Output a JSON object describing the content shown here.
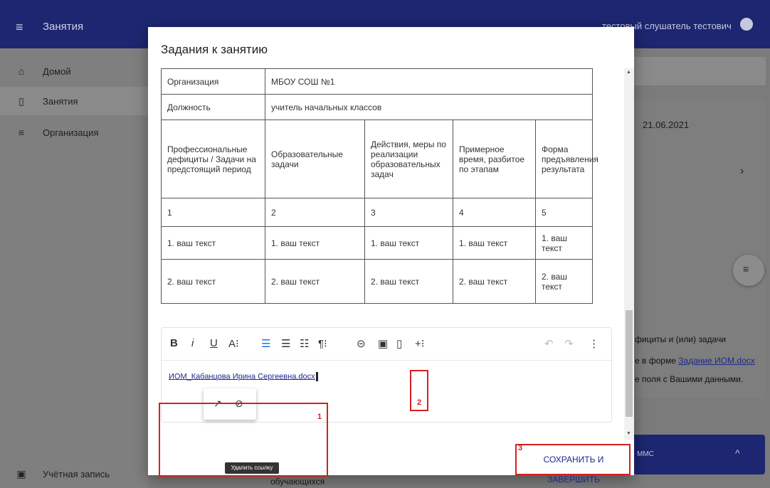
{
  "app_bar": {
    "menu_icon": "menu-icon",
    "title": "Занятия",
    "user_name": "тестовый слушатель тестович",
    "user_icon": "account-icon"
  },
  "sidebar": {
    "items": [
      {
        "icon": "home-icon",
        "glyph": "⌂",
        "label": "Домой"
      },
      {
        "icon": "book-icon",
        "glyph": "▯",
        "label": "Занятия"
      },
      {
        "icon": "list-icon",
        "glyph": "≡",
        "label": "Организация"
      }
    ],
    "account": {
      "icon": "account-box-icon",
      "glyph": "▣",
      "label": "Учётная запись"
    }
  },
  "background": {
    "date": "21.06.2021",
    "text1": "фициты и (или) задачи",
    "text2_prefix": "е в форме ",
    "text2_link": "Задание ИОМ.docx",
    "text3": "е поля с Вашими данными.",
    "bottom_label": "ММС",
    "footer_text": "обучающихся"
  },
  "dialog": {
    "title": "Задания к занятию",
    "table": {
      "org_label": "Организация",
      "org_value": "МБОУ СОШ №1",
      "position_label": "Должность",
      "position_value": "учитель начальных классов",
      "headers": [
        "Профессиональные дефициты / Задачи на предстоящий период",
        "Образовательные задачи",
        "Действия, меры по реализации образовательных задач",
        "Примерное время, разбитое по этапам",
        "Форма предъявления результата"
      ],
      "numbers": [
        "1",
        "2",
        "3",
        "4",
        "5"
      ],
      "row1": [
        "1. ваш текст",
        "1. ваш текст",
        "1. ваш текст",
        "1. ваш текст",
        "1. ваш текст"
      ],
      "row2": [
        "2. ваш текст",
        "2. ваш текст",
        "2. ваш текст",
        "2. ваш текст",
        "2. ваш текст"
      ]
    },
    "toolbar": {
      "bold": "B",
      "italic": "i",
      "underline": "U",
      "font_size": "A⁝",
      "align_left": "☰",
      "align_center": "☰",
      "list": "☷",
      "paragraph": "¶⁝",
      "link": "⊝",
      "image": "▣",
      "file": "▯",
      "more": "+⁝",
      "undo": "↶",
      "redo": "↷",
      "menu": "⋮"
    },
    "editor_link": "ИОМ_Кабанцова Ирина Сергеевна.docx",
    "popup_open": "↗",
    "popup_unlink": "⊘",
    "tooltip": "Удалить ссылку",
    "save_button": "СОХРАНИТЬ И ЗАВЕРШИТЬ"
  },
  "annotations": {
    "n1": "1",
    "n2": "2",
    "n3": "3",
    "color": "#d62020"
  }
}
